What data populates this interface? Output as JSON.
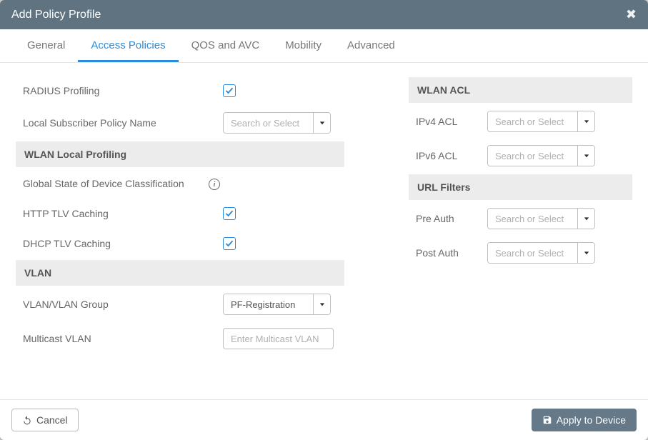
{
  "header": {
    "title": "Add Policy Profile"
  },
  "tabs": {
    "general": "General",
    "access_policies": "Access Policies",
    "qos_avc": "QOS and AVC",
    "mobility": "Mobility",
    "advanced": "Advanced"
  },
  "left": {
    "radius_profiling": {
      "label": "RADIUS Profiling",
      "checked": true
    },
    "local_sub_policy": {
      "label": "Local Subscriber Policy Name",
      "placeholder": "Search or Select",
      "value": ""
    },
    "section_wlan_local_profiling": "WLAN Local Profiling",
    "global_state": {
      "label": "Global State of Device Classification"
    },
    "http_tlv": {
      "label": "HTTP TLV Caching",
      "checked": true
    },
    "dhcp_tlv": {
      "label": "DHCP TLV Caching",
      "checked": true
    },
    "section_vlan": "VLAN",
    "vlan_group": {
      "label": "VLAN/VLAN Group",
      "value": "PF-Registration"
    },
    "multicast_vlan": {
      "label": "Multicast VLAN",
      "placeholder": "Enter Multicast VLAN",
      "value": ""
    }
  },
  "right": {
    "section_wlan_acl": "WLAN ACL",
    "ipv4_acl": {
      "label": "IPv4 ACL",
      "placeholder": "Search or Select",
      "value": ""
    },
    "ipv6_acl": {
      "label": "IPv6 ACL",
      "placeholder": "Search or Select",
      "value": ""
    },
    "section_url_filters": "URL Filters",
    "pre_auth": {
      "label": "Pre Auth",
      "placeholder": "Search or Select",
      "value": ""
    },
    "post_auth": {
      "label": "Post Auth",
      "placeholder": "Search or Select",
      "value": ""
    }
  },
  "footer": {
    "cancel": "Cancel",
    "apply": "Apply to Device"
  }
}
